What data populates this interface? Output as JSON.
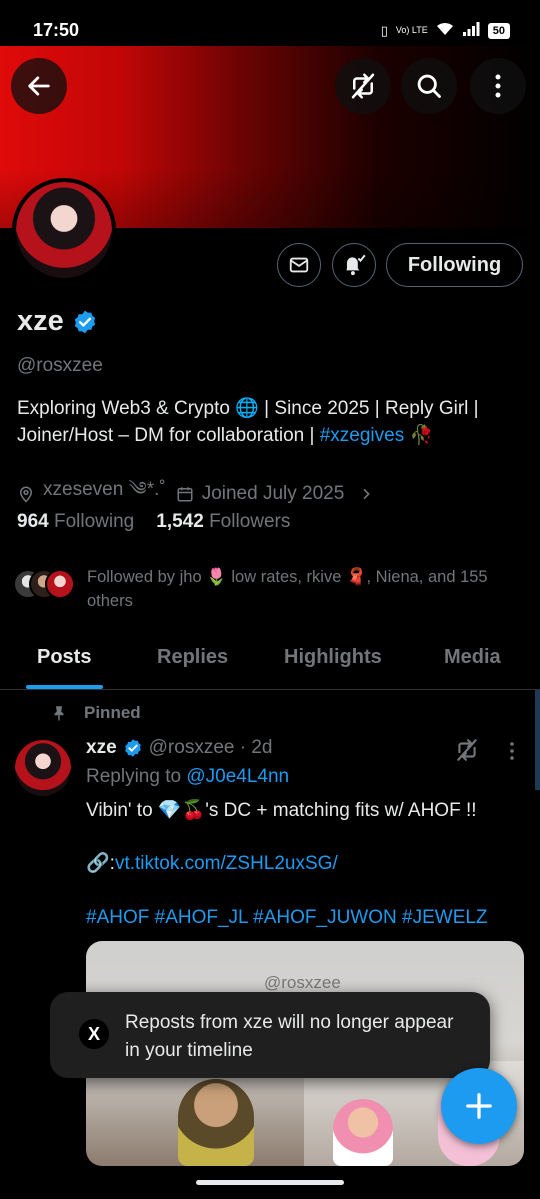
{
  "status_bar": {
    "time": "17:50",
    "network": "Vo) LTE",
    "battery": "50"
  },
  "colors": {
    "accent": "#1d9bf0",
    "banner_red": "#e00a0a",
    "background": "#000000",
    "secondary_text": "#71767b"
  },
  "header": {
    "back_icon": "arrow-left-icon",
    "norepost_icon": "repost-off-icon",
    "search_icon": "search-icon",
    "more_icon": "more-vertical-icon"
  },
  "profile": {
    "name": "xze",
    "handle": "@rosxzee",
    "bio_text": "Exploring Web3 & Crypto 🌐 | Since 2025 | Reply Girl | Joiner/Host – DM for collaboration | ",
    "bio_hashtag": "#xzegives",
    "bio_emoji": "🥀",
    "location": "xzeseven ༄*.˚",
    "joined": "Joined July 2025",
    "following_count": "964",
    "following_label": "Following",
    "followers_count": "1,542",
    "followers_label": "Followers",
    "followed_by": "Followed by jho 🌷 low rates, rkive 🧣, Niena, and 155 others",
    "follow_button": "Following"
  },
  "tabs": [
    {
      "label": "Posts",
      "active": true
    },
    {
      "label": "Replies",
      "active": false
    },
    {
      "label": "Highlights",
      "active": false
    },
    {
      "label": "Media",
      "active": false
    }
  ],
  "post": {
    "pinned_label": "Pinned",
    "name": "xze",
    "handle_time": "@rosxzee · 2d",
    "replying_prefix": "Replying to ",
    "replying_to": "@J0e4L4nn",
    "text": "Vibin' to 💎🍒's DC + matching fits w/ AHOF !!",
    "link_prefix": "🔗:",
    "link": "vt.tiktok.com/ZSHL2uxSG/",
    "hashtags": "#AHOF #AHOF_JL #AHOF_JUWON #JEWELZ",
    "media_watermark": "@rosxzee"
  },
  "toast": {
    "logo": "X",
    "message": "Reposts from xze will no longer appear in your timeline"
  },
  "fab": {
    "icon": "plus-icon"
  }
}
